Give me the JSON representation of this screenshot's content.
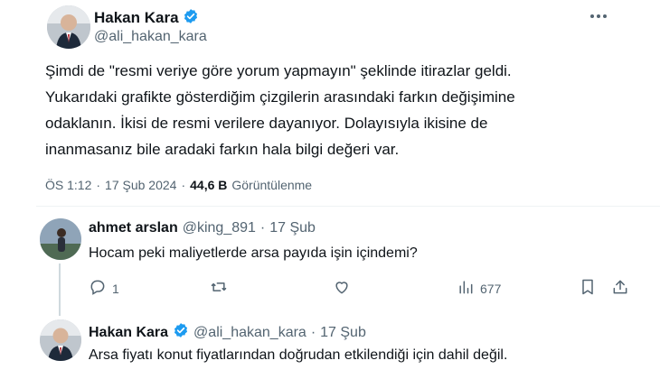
{
  "main_tweet": {
    "author_name": "Hakan Kara",
    "author_handle": "@ali_hakan_kara",
    "text_lines": [
      "Şimdi de \"resmi veriye göre yorum yapmayın\" şeklinde itirazlar geldi.",
      "Yukarıdaki grafikte gösterdiğim çizgilerin arasındaki farkın değişimine",
      "odaklanın. İkisi de resmi verilere dayanıyor. Dolayısıyla ikisine de",
      "inanmasanız bile aradaki farkın hala bilgi değeri var."
    ],
    "time": "ÖS 1:12",
    "separator": "·",
    "date": "17 Şub 2024",
    "views_count": "44,6 B",
    "views_label": "Görüntülenme"
  },
  "reply_1": {
    "author_name": "ahmet arslan",
    "author_handle": "@king_891",
    "separator": "·",
    "date": "17 Şub",
    "text": "Hocam peki maliyetlerde arsa payıda işin içindemi?",
    "reply_count": "1",
    "views_count": "677"
  },
  "reply_2": {
    "author_name": "Hakan Kara",
    "author_handle": "@ali_hakan_kara",
    "separator": "·",
    "date": "17 Şub",
    "text": "Arsa fiyatı konut fiyatlarından doğrudan etkilendiği için dahil değil."
  },
  "icons": {
    "more": "more-horizontal-icon",
    "verified": "verified-badge-icon",
    "reply": "reply-icon",
    "retweet": "retweet-icon",
    "like": "like-icon",
    "views": "views-icon",
    "bookmark": "bookmark-icon",
    "share": "share-icon"
  },
  "colors": {
    "verified_blue": "#1d9bf0",
    "text": "#0f1419",
    "muted": "#536471",
    "divider": "#eff3f4"
  }
}
